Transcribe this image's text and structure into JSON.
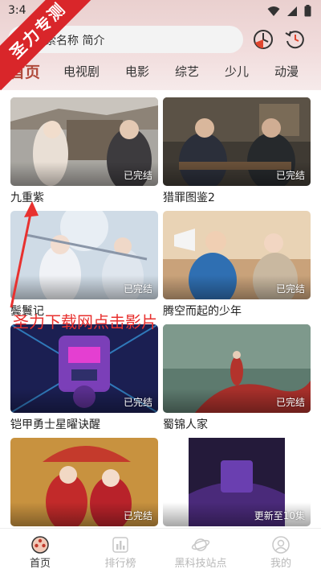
{
  "status_bar": {
    "time": "3:4"
  },
  "search": {
    "placeholder": "索名称 简介"
  },
  "nav_tabs": [
    {
      "label": "首页",
      "active": true
    },
    {
      "label": "电视剧"
    },
    {
      "label": "电影"
    },
    {
      "label": "综艺"
    },
    {
      "label": "少儿"
    },
    {
      "label": "动漫"
    }
  ],
  "cards": [
    {
      "title": "九重紫",
      "badge": "已完结"
    },
    {
      "title": "猎罪图鉴2",
      "badge": "已完结"
    },
    {
      "title": "鬓鬟记",
      "badge": "已完结"
    },
    {
      "title": "腾空而起的少年",
      "badge": "已完结"
    },
    {
      "title": "铠甲勇士星曜诀醒",
      "badge": "已完结"
    },
    {
      "title": "蜀锦人家",
      "badge": "已完结"
    },
    {
      "title": "",
      "badge": "已完结"
    },
    {
      "title": "",
      "badge": "更新至10集"
    }
  ],
  "bottom_nav": [
    {
      "label": "首页",
      "icon": "film-reel-icon",
      "active": true
    },
    {
      "label": "排行榜",
      "icon": "bar-chart-icon"
    },
    {
      "label": "黑科技站点",
      "icon": "planet-icon"
    },
    {
      "label": "我的",
      "icon": "user-icon"
    }
  ],
  "overlays": {
    "corner_ribbon": "圣力专测",
    "watermark": "圣力下载网点击影片"
  },
  "colors": {
    "accent": "#b04a3b",
    "header_bg": "#ecd5d4",
    "watermark_red": "#e8312f"
  }
}
